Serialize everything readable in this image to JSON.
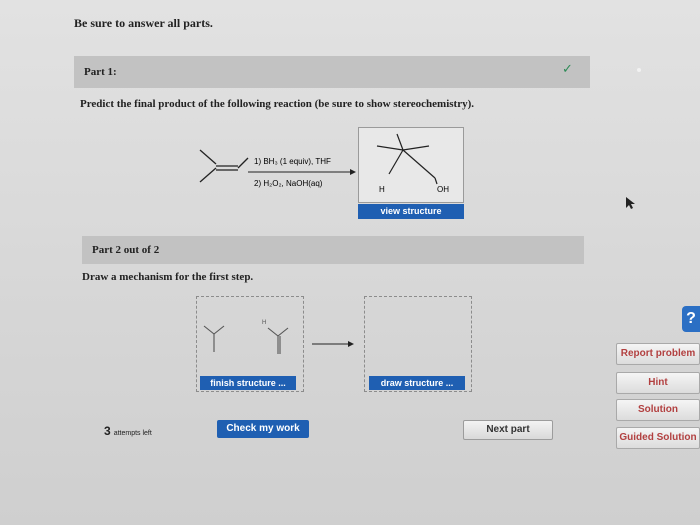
{
  "header": {
    "instructions": "Be sure to answer all parts."
  },
  "part1": {
    "label": "Part 1:",
    "status_icon": "checkmark-icon",
    "question": "Predict the final product of the following reaction (be sure to show stereochemistry).",
    "reagent1": "1) BH₃ (1 equiv), THF",
    "reagent2": "2) H₂O₂, NaOH(aq)",
    "product_label_h": "H",
    "product_label_oh": "OH",
    "view_button": "view structure"
  },
  "part2": {
    "label": "Part 2 out of 2",
    "question": "Draw a mechanism for the first step.",
    "finish_button": "finish structure ...",
    "draw_button": "draw structure ...",
    "h_label": "H"
  },
  "footer": {
    "attempts_count": "3",
    "attempts_label": "attempts left",
    "check_button": "Check my work",
    "next_button": "Next part"
  },
  "sidebar": {
    "help": "?",
    "report": "Report problem",
    "hint": "Hint",
    "solution": "Solution",
    "guided": "Guided Solution"
  },
  "colors": {
    "primary_button": "#1f5fb2",
    "side_text": "#b24040",
    "check": "#2e8b57"
  }
}
